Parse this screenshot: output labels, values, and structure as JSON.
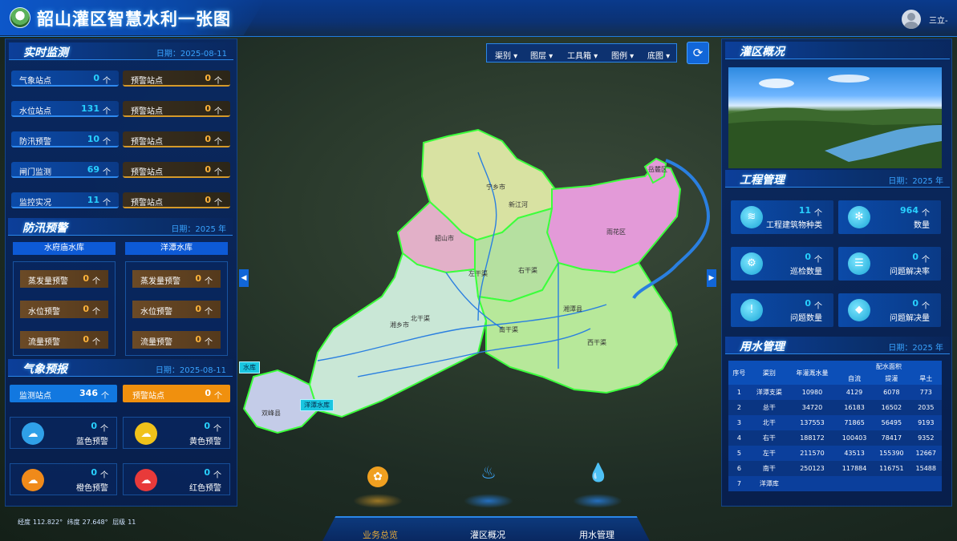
{
  "app": {
    "title": "韶山灌区智慧水利一张图",
    "user_name": "三立-"
  },
  "realtime": {
    "title": "实时监测",
    "date": "日期：2025-08-11",
    "rows": [
      {
        "label": "气象站点",
        "value": "0",
        "unit": "个",
        "warn_label": "预警站点",
        "warn_value": "0",
        "warn_unit": "个"
      },
      {
        "label": "水位站点",
        "value": "131",
        "unit": "个",
        "warn_label": "预警站点",
        "warn_value": "0",
        "warn_unit": "个"
      },
      {
        "label": "防汛预警",
        "value": "10",
        "unit": "个",
        "warn_label": "预警站点",
        "warn_value": "0",
        "warn_unit": "个"
      },
      {
        "label": "闸门监测",
        "value": "69",
        "unit": "个",
        "warn_label": "预警站点",
        "warn_value": "0",
        "warn_unit": "个"
      },
      {
        "label": "监控实况",
        "value": "11",
        "unit": "个",
        "warn_label": "预警站点",
        "warn_value": "0",
        "warn_unit": "个"
      }
    ]
  },
  "flood": {
    "title": "防汛预警",
    "date": "日期：2025 年",
    "reservoirs": [
      {
        "name": "水府庙水库",
        "items": [
          {
            "label": "蒸发量预警",
            "value": "0",
            "unit": "个"
          },
          {
            "label": "水位预警",
            "value": "0",
            "unit": "个"
          },
          {
            "label": "流量预警",
            "value": "0",
            "unit": "个"
          }
        ]
      },
      {
        "name": "洋潭水库",
        "items": [
          {
            "label": "蒸发量预警",
            "value": "0",
            "unit": "个"
          },
          {
            "label": "水位预警",
            "value": "0",
            "unit": "个"
          },
          {
            "label": "流量预警",
            "value": "0",
            "unit": "个"
          }
        ]
      }
    ]
  },
  "weather": {
    "title": "气象预报",
    "date": "日期：2025-08-11",
    "monitor": {
      "label": "监测站点",
      "value": "346",
      "unit": "个"
    },
    "warn": {
      "label": "预警站点",
      "value": "0",
      "unit": "个"
    },
    "alerts": [
      {
        "label": "蓝色预警",
        "value": "0",
        "unit": "个",
        "color": "#2fa0e8",
        "icon": "cloud-rain-icon",
        "glyph": "☁"
      },
      {
        "label": "黄色预警",
        "value": "0",
        "unit": "个",
        "color": "#f0c21a",
        "icon": "cloud-rain-icon",
        "glyph": "☁"
      },
      {
        "label": "橙色预警",
        "value": "0",
        "unit": "个",
        "color": "#f08a1a",
        "icon": "cloud-rain-icon",
        "glyph": "☁"
      },
      {
        "label": "红色预警",
        "value": "0",
        "unit": "个",
        "color": "#e83a3a",
        "icon": "cloud-rain-icon",
        "glyph": "☁"
      }
    ]
  },
  "coords": {
    "lng_label": "经度",
    "lng": "112.822°",
    "lat_label": "纬度",
    "lat": "27.648°",
    "level_label": "层级",
    "level": "11"
  },
  "toolbar": {
    "items": [
      "渠别 ▾",
      "图层 ▾",
      "工具箱 ▾",
      "图例 ▾",
      "底图 ▾"
    ],
    "refresh_glyph": "⟳"
  },
  "map_labels": {
    "ningxiang": "宁乡市",
    "xinjiang": "新江河",
    "yuelu": "岳麓区",
    "yuhua": "雨花区",
    "zuogan": "左干渠",
    "yougan": "右干渠",
    "beigan": "北干渠",
    "nangan": "南干渠",
    "xiangxiang": "湘乡市",
    "xiangtan": "湘潭县",
    "xigan": "西干渠",
    "shuangfeng": "双峰县",
    "res1": "水库",
    "res2": "洋潭水库",
    "shaoshan": "韶山市"
  },
  "overview": {
    "title": "灌区概况"
  },
  "engineering": {
    "title": "工程管理",
    "date": "日期：2025 年",
    "cards": [
      {
        "value": "11",
        "unit": "个",
        "label": "工程建筑物种类",
        "icon": "layers-icon",
        "glyph": "≋"
      },
      {
        "value": "964",
        "unit": "个",
        "label": "数量",
        "icon": "fan-icon",
        "glyph": "✻"
      },
      {
        "value": "0",
        "unit": "个",
        "label": "巡检数量",
        "icon": "inspect-icon",
        "glyph": "⚙"
      },
      {
        "value": "0",
        "unit": "个",
        "label": "问题解决率",
        "icon": "list-icon",
        "glyph": "☰"
      },
      {
        "value": "0",
        "unit": "个",
        "label": "问题数量",
        "icon": "alert-icon",
        "glyph": "!"
      },
      {
        "value": "0",
        "unit": "个",
        "label": "问题解决量",
        "icon": "cube-icon",
        "glyph": "◆"
      }
    ]
  },
  "water_use": {
    "title": "用水管理",
    "date": "日期：2025 年",
    "headers": {
      "index": "序号",
      "canal": "渠别",
      "annual": "年灌溉水量",
      "dist": "配水面积",
      "self": "自流",
      "lift": "提灌",
      "dry": "旱土"
    },
    "rows": [
      [
        "1",
        "洋潭支渠",
        "10980",
        "4129",
        "6078",
        "773"
      ],
      [
        "2",
        "总干",
        "34720",
        "16183",
        "16502",
        "2035"
      ],
      [
        "3",
        "北干",
        "137553",
        "71865",
        "56495",
        "9193"
      ],
      [
        "4",
        "右干",
        "188172",
        "100403",
        "78417",
        "9352"
      ],
      [
        "5",
        "左干",
        "211570",
        "43513",
        "155390",
        "12667"
      ],
      [
        "6",
        "南干",
        "250123",
        "117884",
        "116751",
        "15488"
      ],
      [
        "7",
        "洋潭库",
        "",
        "",
        "",
        ""
      ]
    ]
  },
  "bottom_nav": {
    "tabs": [
      "业务总览",
      "灌区概况",
      "用水管理"
    ]
  }
}
